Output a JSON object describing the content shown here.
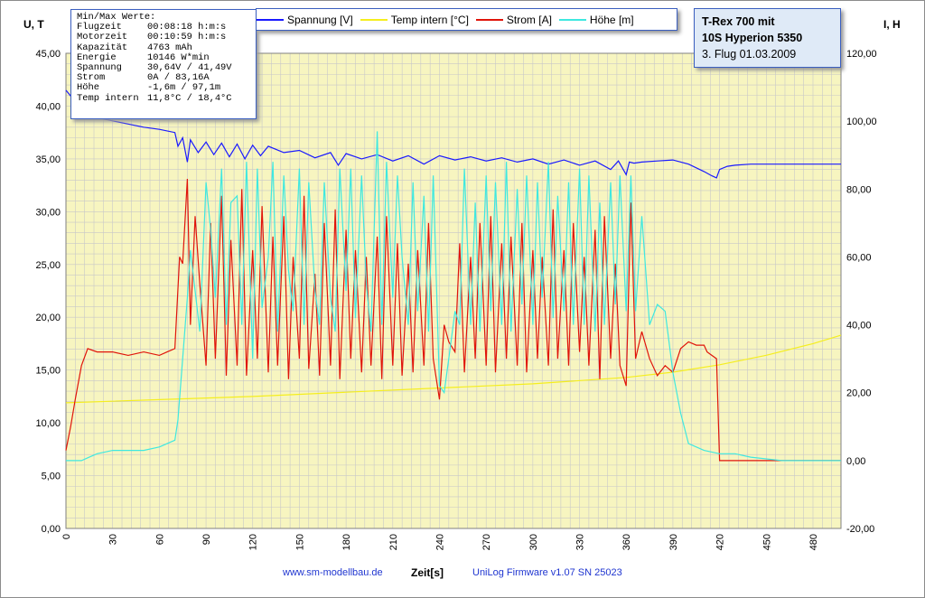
{
  "stats": {
    "heading": "Min/Max Werte:",
    "rows": [
      {
        "label": "Flugzeit",
        "value": "00:08:18 h:m:s"
      },
      {
        "label": "Motorzeit",
        "value": "00:10:59 h:m:s"
      },
      {
        "label": "Kapazität",
        "value": "4763 mAh"
      },
      {
        "label": "Energie",
        "value": "10146 W*min"
      },
      {
        "label": "Spannung",
        "value": "30,64V / 41,49V"
      },
      {
        "label": "Strom",
        "value": "0A / 83,16A"
      },
      {
        "label": "Höhe",
        "value": "-1,6m / 97,1m"
      },
      {
        "label": "Temp intern",
        "value": "11,8°C / 18,4°C"
      }
    ]
  },
  "title_box": {
    "line1": "T-Rex 700 mit",
    "line2": "10S Hyperion 5350",
    "line3": "3. Flug 01.03.2009"
  },
  "footer": {
    "website": "www.sm-modellbau.de",
    "firmware": "UniLog Firmware v1.07 SN 25023"
  },
  "colors": {
    "plot_bg": "#f7f5c0",
    "grid": "#c8c8c8",
    "spannung": "#1a1aff",
    "temp": "#f5ee1e",
    "strom": "#e0140a",
    "hoehe": "#3fe8e0"
  },
  "chart_data": {
    "type": "line",
    "xlabel": "Zeit[s]",
    "ylabel_left": "U, T",
    "ylabel_right": "I, H",
    "xlim": [
      0,
      498
    ],
    "ylim_left": [
      0,
      45
    ],
    "ylim_right": [
      -20,
      120
    ],
    "x_ticks": [
      0,
      30,
      60,
      90,
      120,
      150,
      180,
      210,
      240,
      270,
      300,
      330,
      360,
      390,
      420,
      450,
      480
    ],
    "y_left_ticks": [
      "0,00",
      "5,00",
      "10,00",
      "15,00",
      "20,00",
      "25,00",
      "30,00",
      "35,00",
      "40,00",
      "45,00"
    ],
    "y_right_ticks": [
      "-20,00",
      "0,00",
      "20,00",
      "40,00",
      "60,00",
      "80,00",
      "100,00",
      "120,00"
    ],
    "grid": true,
    "legend_position": "top",
    "series": [
      {
        "name": "Spannung [V]",
        "axis": "left",
        "x": [
          0,
          5,
          10,
          15,
          20,
          30,
          40,
          50,
          60,
          70,
          72,
          75,
          78,
          80,
          85,
          90,
          95,
          100,
          105,
          110,
          115,
          120,
          125,
          130,
          140,
          150,
          160,
          170,
          175,
          180,
          190,
          200,
          210,
          220,
          230,
          240,
          250,
          260,
          270,
          280,
          290,
          300,
          310,
          320,
          330,
          340,
          350,
          355,
          360,
          362,
          365,
          370,
          380,
          390,
          400,
          410,
          415,
          418,
          420,
          425,
          430,
          440,
          450,
          460,
          470,
          480,
          490,
          498
        ],
        "y": [
          41.5,
          40.6,
          39.8,
          39.2,
          38.9,
          38.6,
          38.3,
          38.0,
          37.8,
          37.5,
          36.2,
          37.0,
          34.7,
          36.8,
          35.6,
          36.6,
          35.4,
          36.5,
          35.2,
          36.4,
          35.0,
          36.3,
          35.3,
          36.2,
          35.6,
          35.8,
          35.1,
          35.6,
          34.4,
          35.5,
          35.0,
          35.4,
          34.8,
          35.3,
          34.5,
          35.3,
          34.9,
          35.2,
          34.8,
          35.1,
          34.7,
          35.0,
          34.5,
          34.9,
          34.4,
          34.8,
          34.0,
          34.8,
          33.5,
          34.7,
          34.6,
          34.7,
          34.8,
          34.9,
          34.5,
          33.8,
          33.4,
          33.2,
          34.0,
          34.3,
          34.4,
          34.5,
          34.5,
          34.5,
          34.5,
          34.5,
          34.5,
          34.5
        ]
      },
      {
        "name": "Temp intern [°C]",
        "axis": "left",
        "x": [
          0,
          60,
          120,
          180,
          240,
          300,
          360,
          390,
          420,
          450,
          480,
          498
        ],
        "y": [
          11.9,
          12.2,
          12.5,
          12.9,
          13.3,
          13.7,
          14.3,
          14.8,
          15.5,
          16.4,
          17.5,
          18.3
        ]
      },
      {
        "name": "Strom [A]",
        "axis": "right",
        "x": [
          0,
          3,
          6,
          10,
          14,
          20,
          30,
          40,
          50,
          60,
          65,
          70,
          73,
          75,
          78,
          80,
          83,
          86,
          90,
          93,
          96,
          100,
          103,
          106,
          110,
          113,
          116,
          120,
          123,
          126,
          130,
          133,
          136,
          140,
          143,
          146,
          150,
          153,
          156,
          160,
          163,
          166,
          170,
          173,
          176,
          180,
          183,
          186,
          190,
          193,
          196,
          200,
          203,
          206,
          210,
          213,
          216,
          220,
          223,
          226,
          230,
          233,
          236,
          240,
          243,
          246,
          250,
          253,
          256,
          260,
          263,
          266,
          270,
          273,
          276,
          280,
          283,
          286,
          290,
          293,
          296,
          300,
          303,
          306,
          310,
          313,
          316,
          320,
          323,
          326,
          330,
          333,
          336,
          340,
          343,
          346,
          350,
          353,
          356,
          360,
          363,
          366,
          370,
          375,
          380,
          385,
          390,
          395,
          400,
          405,
          410,
          412,
          415,
          418,
          420,
          430,
          440,
          460,
          480,
          498
        ],
        "y": [
          3,
          10,
          18,
          28,
          33,
          32,
          32,
          31,
          32,
          31,
          32,
          33,
          60,
          58,
          83,
          40,
          72,
          52,
          28,
          70,
          30,
          78,
          25,
          65,
          28,
          80,
          25,
          62,
          30,
          75,
          26,
          66,
          28,
          72,
          24,
          60,
          30,
          78,
          27,
          55,
          25,
          70,
          28,
          74,
          24,
          68,
          30,
          62,
          26,
          60,
          28,
          66,
          24,
          72,
          28,
          64,
          25,
          58,
          26,
          62,
          28,
          70,
          30,
          18,
          40,
          35,
          32,
          64,
          26,
          60,
          30,
          70,
          28,
          72,
          26,
          64,
          30,
          66,
          28,
          70,
          26,
          62,
          30,
          60,
          28,
          74,
          30,
          62,
          28,
          70,
          32,
          60,
          28,
          68,
          24,
          72,
          30,
          58,
          28,
          22,
          76,
          30,
          38,
          30,
          25,
          28,
          26,
          33,
          35,
          34,
          34,
          32,
          31,
          30,
          0,
          0,
          0,
          0,
          0,
          0
        ]
      },
      {
        "name": "Höhe [m]",
        "axis": "right",
        "x": [
          0,
          5,
          10,
          15,
          20,
          30,
          40,
          50,
          60,
          65,
          70,
          72,
          75,
          78,
          80,
          83,
          86,
          90,
          93,
          96,
          100,
          103,
          106,
          110,
          113,
          116,
          120,
          123,
          126,
          130,
          133,
          136,
          140,
          143,
          146,
          150,
          153,
          156,
          160,
          163,
          166,
          170,
          173,
          176,
          180,
          183,
          186,
          190,
          193,
          196,
          200,
          203,
          206,
          210,
          213,
          216,
          220,
          223,
          226,
          230,
          233,
          236,
          240,
          243,
          246,
          250,
          253,
          256,
          260,
          263,
          266,
          270,
          273,
          276,
          280,
          283,
          286,
          290,
          293,
          296,
          300,
          303,
          306,
          310,
          313,
          316,
          320,
          323,
          326,
          330,
          333,
          336,
          340,
          343,
          346,
          350,
          353,
          356,
          360,
          363,
          366,
          370,
          375,
          380,
          385,
          390,
          395,
          400,
          410,
          420,
          430,
          440,
          460,
          480,
          498
        ],
        "y": [
          0,
          0,
          0,
          1,
          2,
          3,
          3,
          3,
          4,
          5,
          6,
          12,
          30,
          48,
          62,
          50,
          38,
          82,
          68,
          48,
          86,
          40,
          76,
          78,
          40,
          88,
          30,
          86,
          45,
          60,
          88,
          38,
          84,
          56,
          44,
          86,
          40,
          82,
          50,
          40,
          82,
          48,
          38,
          86,
          50,
          86,
          42,
          84,
          52,
          38,
          97,
          40,
          88,
          48,
          84,
          60,
          40,
          82,
          44,
          78,
          38,
          84,
          22,
          20,
          30,
          44,
          40,
          86,
          40,
          76,
          38,
          84,
          44,
          82,
          40,
          88,
          38,
          80,
          46,
          84,
          40,
          82,
          48,
          88,
          42,
          78,
          44,
          82,
          40,
          86,
          40,
          84,
          38,
          76,
          40,
          82,
          46,
          84,
          44,
          84,
          44,
          72,
          40,
          46,
          44,
          26,
          14,
          5,
          3,
          2,
          2,
          1,
          0,
          0,
          0
        ]
      }
    ]
  }
}
